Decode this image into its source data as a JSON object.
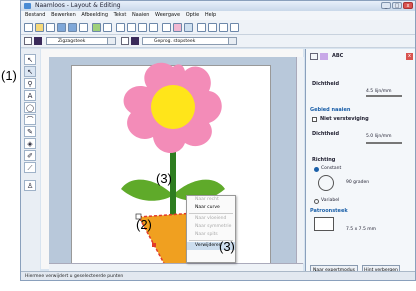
{
  "app": {
    "title": "Naamloos - Layout & Editing"
  },
  "menu": [
    "Bestand",
    "Bewerken",
    "Afbeelding",
    "Tekst",
    "Naaien",
    "Weergave",
    "Optie",
    "Help"
  ],
  "toolbar2": {
    "line_combo": "Zigzagsteek",
    "fill_combo": "Geprog. stopsteek"
  },
  "callouts": {
    "c1": "(1)",
    "c2": "(2)",
    "c3a": "(3)",
    "c3b": "(3)"
  },
  "context_menu": [
    {
      "label": "Naar recht",
      "enabled": false
    },
    {
      "label": "Naar curve",
      "enabled": true
    },
    {
      "label": "Naar vloeiend",
      "enabled": false
    },
    {
      "label": "Naar symmetrie",
      "enabled": false
    },
    {
      "label": "Naar spits",
      "enabled": false
    },
    {
      "label": "Verwijderen",
      "enabled": true
    }
  ],
  "panel": {
    "tab_abc": "ABC",
    "density_label": "Dichtheid",
    "density_value_1": "4.5 lijn/mm",
    "section_area": "Gebied naaien",
    "no_reinforce": "Niet versteviging",
    "density_value_2": "5.0 lijn/mm",
    "direction_label": "Richting",
    "constant_label": "Constant",
    "angle_value": "90 graden",
    "variable_label": "Variabel",
    "section_pattern": "Patroonsteek",
    "pattern_size": "7.5 x 7.5 mm",
    "btn_expert": "Naar expertmodus",
    "btn_hide": "Hint verbergen"
  },
  "status": {
    "text": "Hiermee verwijdert u geselecteerde punten"
  },
  "colors": {
    "petal": "#f38cb8",
    "center": "#ffe51a",
    "leaf": "#5faa2a",
    "stem": "#2e7d20",
    "pot": "#f0a020",
    "selection": "#e23a2a"
  }
}
